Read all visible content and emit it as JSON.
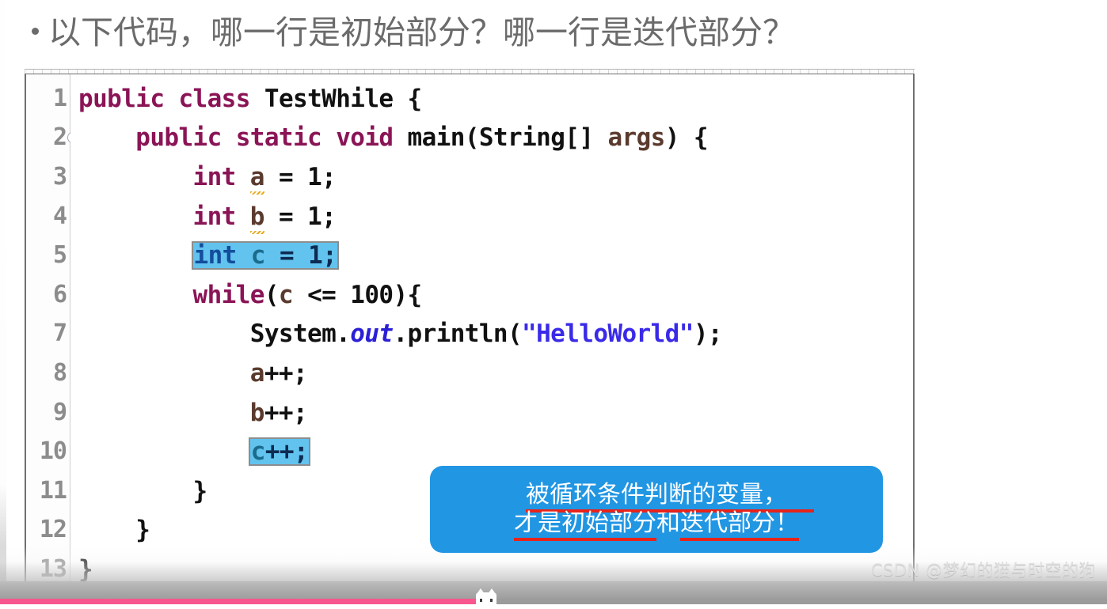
{
  "slide": {
    "bullet_glyph": "•",
    "title": "以下代码，哪一行是初始部分？哪一行是迭代部分？"
  },
  "editor": {
    "line_numbers": [
      "1",
      "2",
      "3",
      "4",
      "5",
      "6",
      "7",
      "8",
      "9",
      "10",
      "11",
      "12",
      "13"
    ],
    "fold_marker_line": "2",
    "lines": [
      {
        "n": "1",
        "text": "public class TestWhile {"
      },
      {
        "n": "2",
        "text": "    public static void main(String[] args) {"
      },
      {
        "n": "3",
        "text": "        int a = 1;"
      },
      {
        "n": "4",
        "text": "        int b = 1;"
      },
      {
        "n": "5",
        "text": "        int c = 1;"
      },
      {
        "n": "6",
        "text": "        while(c <= 100){"
      },
      {
        "n": "7",
        "text": "            System.out.println(\"HelloWorld\");"
      },
      {
        "n": "8",
        "text": "            a++;"
      },
      {
        "n": "9",
        "text": "            b++;"
      },
      {
        "n": "10",
        "text": "            c++;"
      },
      {
        "n": "11",
        "text": "        }"
      },
      {
        "n": "12",
        "text": "    }"
      },
      {
        "n": "13",
        "text": "}"
      }
    ],
    "tokens": {
      "kw_public": "public",
      "kw_class": "class",
      "kw_static": "static",
      "kw_void": "void",
      "kw_int": "int",
      "kw_while": "while",
      "type_TestWhile": "TestWhile",
      "type_String": "String",
      "id_main": "main",
      "id_args": "args",
      "id_System": "System",
      "id_out": "out",
      "id_println": "println",
      "str_hello": "\"HelloWorld\"",
      "var_a": "a",
      "var_b": "b",
      "var_c": "c",
      "num_1": "1",
      "num_100": "100"
    },
    "highlighted_lines": [
      "5",
      "10"
    ],
    "highlight_color": "#61c3ee",
    "warning_underline_vars": [
      "a",
      "b"
    ]
  },
  "callout": {
    "line1_underlined": "被循环条件判断的变量，",
    "line2_part1_underlined": "才是初始部分",
    "line2_part2_plain": "和",
    "line2_part3_underlined": "迭代部分！",
    "background_color": "#2196e3",
    "text_color": "#ffffff",
    "underline_color": "#e8231a"
  },
  "watermark": {
    "text": "CSDN @梦幻的猫与时空的狗"
  },
  "player": {
    "progress_percent": "43",
    "progress_color": "#f7568f",
    "track_color": "#9b9b9b"
  }
}
